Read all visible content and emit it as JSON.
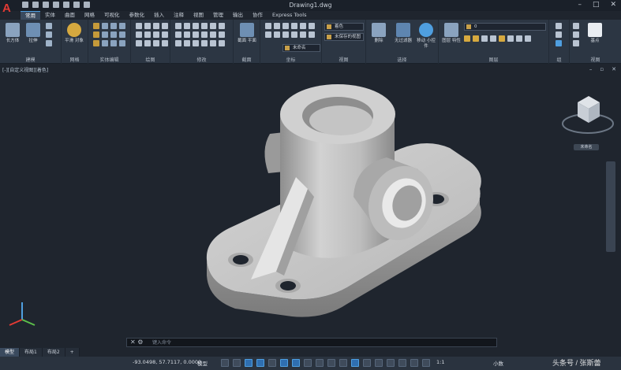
{
  "title_bar": {
    "document_title": "Drawing1.dwg",
    "logo_letter": "A"
  },
  "ribbon_tabs": [
    "常用",
    "实体",
    "曲面",
    "网格",
    "可视化",
    "参数化",
    "插入",
    "注释",
    "视图",
    "管理",
    "输出",
    "协作",
    "Express Tools"
  ],
  "ribbon": {
    "modeling": {
      "label": "建模",
      "box": "长方体",
      "extrude": "拉伸",
      "smooth": "平滑\n对象"
    },
    "mesh_label": "网格",
    "solid_edit_label": "实体编辑",
    "draw_label": "绘图",
    "modify_label": "修改",
    "section": {
      "button": "截面\n平面",
      "label": "截面"
    },
    "coords_label": "坐标",
    "view": {
      "style_value": "着色",
      "saved_view": "未保存的视图",
      "world_ucs": "未命名",
      "label": "视图"
    },
    "selection": {
      "culling": "删除",
      "no_filter": "无过滤器",
      "gizmo": "移动\n小控件",
      "label": "选择"
    },
    "layers": {
      "properties": "图层\n特性",
      "current_layer": "0",
      "label": "图层"
    },
    "groups": {
      "label": "组"
    },
    "view2": {
      "base": "基点",
      "label": "视图"
    }
  },
  "viewport": {
    "label": "[-][自定义视图][着色]",
    "viewcube_label": "未命名"
  },
  "command_line": {
    "prompt": "键入命令"
  },
  "layout_tabs": [
    "模型",
    "布局1",
    "布局2",
    "+"
  ],
  "status_bar": {
    "coordinates": "-93.0498, 57.7117, 0.0000",
    "model": "模型",
    "scale": "1:1",
    "units": "小数"
  },
  "watermark": "头条号 / 张斯蕾",
  "colors": {
    "accent": "#4f9fe0",
    "logo": "#e23a34",
    "background": "#1f252e"
  }
}
